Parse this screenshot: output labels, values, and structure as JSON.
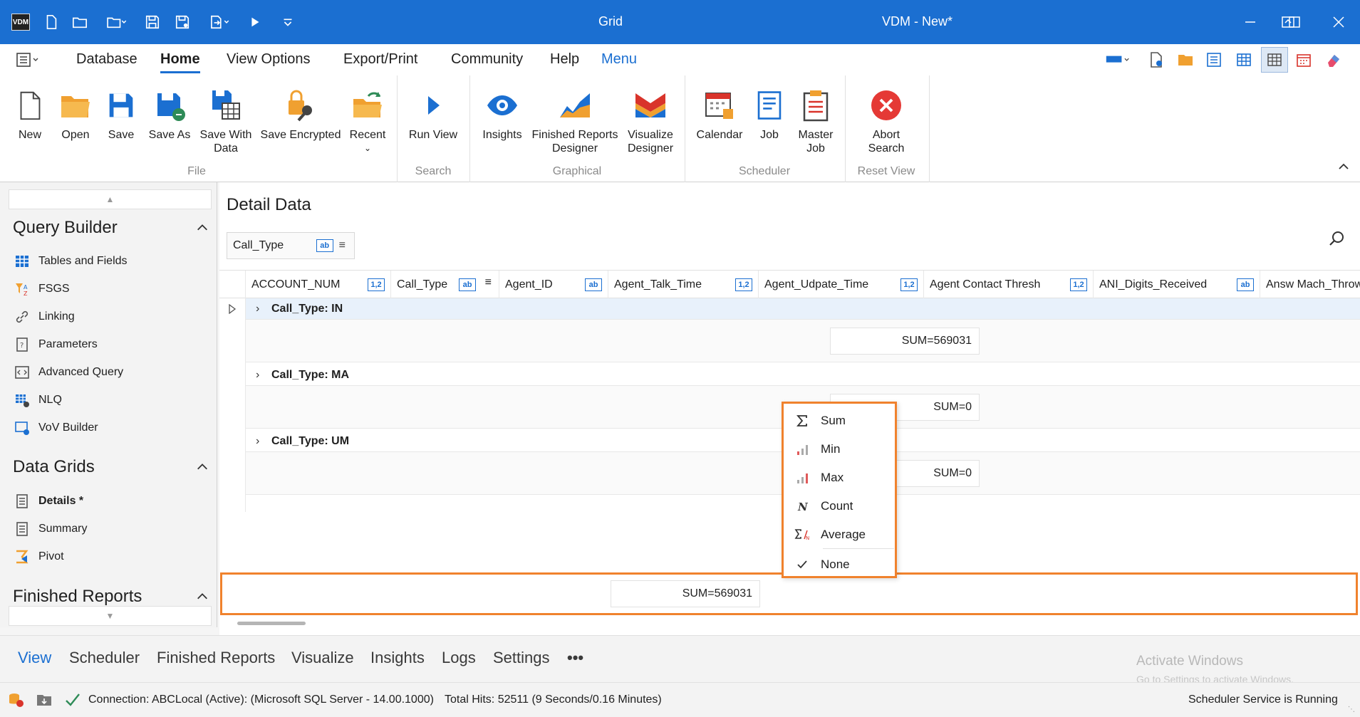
{
  "titlebar": {
    "logo": "VDM",
    "center_title": "Grid",
    "app_title": "VDM - New*"
  },
  "menu": {
    "items": [
      "Database",
      "Home",
      "View Options",
      "Export/Print",
      "Community",
      "Help",
      "Menu"
    ],
    "active": "Home"
  },
  "ribbon": {
    "buttons": {
      "new": "New",
      "open": "Open",
      "save": "Save",
      "save_as": "Save As",
      "save_with_data_1": "Save With",
      "save_with_data_2": "Data",
      "save_encrypted": "Save Encrypted",
      "recent": "Recent",
      "run_view": "Run View",
      "insights": "Insights",
      "finished_reports_1": "Finished Reports",
      "finished_reports_2": "Designer",
      "visualize_1": "Visualize",
      "visualize_2": "Designer",
      "calendar": "Calendar",
      "job": "Job",
      "master_job_1": "Master",
      "master_job_2": "Job",
      "abort_1": "Abort",
      "abort_2": "Search"
    },
    "groups": {
      "file": "File",
      "search": "Search",
      "graphical": "Graphical",
      "scheduler": "Scheduler",
      "reset_view": "Reset View"
    }
  },
  "leftpanel": {
    "query_builder": {
      "title": "Query Builder",
      "items": [
        "Tables and Fields",
        "FSGS",
        "Linking",
        "Parameters",
        "Advanced Query",
        "NLQ",
        "VoV Builder"
      ]
    },
    "data_grids": {
      "title": "Data Grids",
      "items": [
        "Details *",
        "Summary",
        "Pivot"
      ]
    },
    "finished_reports": {
      "title": "Finished Reports"
    }
  },
  "main": {
    "title": "Detail Data",
    "group_chip": "Call_Type",
    "columns": [
      {
        "label": "ACCOUNT_NUM",
        "type": "1,2"
      },
      {
        "label": "Call_Type",
        "type": "ab"
      },
      {
        "label": "Agent_ID",
        "type": "ab"
      },
      {
        "label": "Agent_Talk_Time",
        "type": "1,2"
      },
      {
        "label": "Agent_Udpate_Time",
        "type": "1,2"
      },
      {
        "label": "Agent Contact Thresh",
        "type": "1,2"
      },
      {
        "label": "ANI_Digits_Received",
        "type": "ab"
      },
      {
        "label": "Answ Mach_Throw",
        "type": ""
      }
    ],
    "groups": [
      {
        "label": "Call_Type: IN",
        "sum": "SUM=569031"
      },
      {
        "label": "Call_Type: MA",
        "sum": "SUM=0"
      },
      {
        "label": "Call_Type: UM",
        "sum": "SUM=0"
      }
    ],
    "total_sum": "SUM=569031"
  },
  "context_menu": {
    "items": [
      {
        "label": "Sum",
        "icon": "sigma-icon"
      },
      {
        "label": "Min",
        "icon": "bar-chart-min-icon"
      },
      {
        "label": "Max",
        "icon": "bar-chart-max-icon"
      },
      {
        "label": "Count",
        "icon": "count-n-icon"
      },
      {
        "label": "Average",
        "icon": "average-icon"
      },
      {
        "label": "None",
        "icon": "check-icon"
      }
    ],
    "selected": "None"
  },
  "bottomnav": {
    "items": [
      "View",
      "Scheduler",
      "Finished Reports",
      "Visualize",
      "Insights",
      "Logs",
      "Settings",
      "•••"
    ],
    "active": "View"
  },
  "watermark": {
    "line1": "Activate Windows",
    "line2": "Go to Settings to activate Windows."
  },
  "status": {
    "connection": "Connection: ABCLocal (Active): (Microsoft SQL Server - 14.00.1000)",
    "hits": "Total Hits: 52511 (9 Seconds/0.16 Minutes)",
    "scheduler": "Scheduler Service is Running"
  },
  "colors": {
    "accent": "#1b6fd1",
    "highlight": "#f0822d"
  }
}
